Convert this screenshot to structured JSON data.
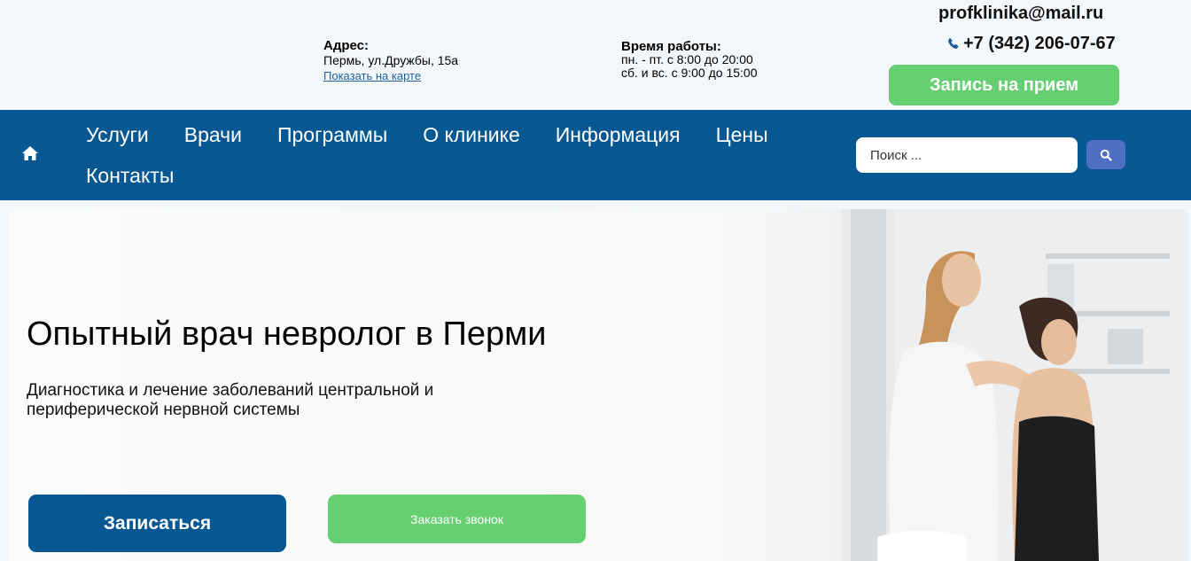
{
  "header": {
    "address_label": "Адрес:",
    "address_value": "Пермь, ул.Дружбы, 15а",
    "map_link": "Показать на карте",
    "hours_label": "Время работы:",
    "hours_weekdays": "пн. - пт. с 8:00 до 20:00",
    "hours_weekend": "сб. и вс. с 9:00 до 15:00",
    "email": "profklinika@mail.ru",
    "phone": "+7 (342) 206-07-67",
    "appointment_button": "Запись на прием"
  },
  "nav": {
    "items": [
      {
        "label": "Услуги"
      },
      {
        "label": "Врачи"
      },
      {
        "label": "Программы"
      },
      {
        "label": "О клинике"
      },
      {
        "label": "Информация"
      },
      {
        "label": "Цены"
      },
      {
        "label": "Контакты"
      }
    ],
    "search_placeholder": "Поиск ..."
  },
  "hero": {
    "title": "Опытный врач невролог в Перми",
    "subtitle": "Диагностика и лечение заболеваний центральной и периферической нервной системы",
    "signup_button": "Записаться",
    "callback_button": "Заказать звонок"
  },
  "colors": {
    "nav_bg": "#075892",
    "accent_green": "#66cf72",
    "search_btn": "#4e6fc4"
  }
}
